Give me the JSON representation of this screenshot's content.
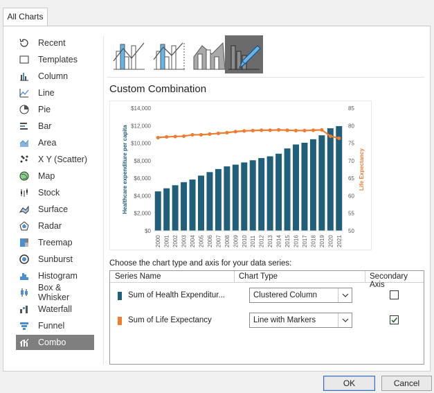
{
  "tabs": [
    {
      "label": "All Charts"
    }
  ],
  "sidebar": {
    "items": [
      {
        "label": "Recent",
        "icon": "recent-icon"
      },
      {
        "label": "Templates",
        "icon": "templates-icon"
      },
      {
        "label": "Column",
        "icon": "column-chart-icon"
      },
      {
        "label": "Line",
        "icon": "line-chart-icon"
      },
      {
        "label": "Pie",
        "icon": "pie-chart-icon"
      },
      {
        "label": "Bar",
        "icon": "bar-chart-icon"
      },
      {
        "label": "Area",
        "icon": "area-chart-icon"
      },
      {
        "label": "X Y (Scatter)",
        "icon": "scatter-chart-icon"
      },
      {
        "label": "Map",
        "icon": "map-chart-icon"
      },
      {
        "label": "Stock",
        "icon": "stock-chart-icon"
      },
      {
        "label": "Surface",
        "icon": "surface-chart-icon"
      },
      {
        "label": "Radar",
        "icon": "radar-chart-icon"
      },
      {
        "label": "Treemap",
        "icon": "treemap-chart-icon"
      },
      {
        "label": "Sunburst",
        "icon": "sunburst-chart-icon"
      },
      {
        "label": "Histogram",
        "icon": "histogram-chart-icon"
      },
      {
        "label": "Box & Whisker",
        "icon": "box-whisker-chart-icon"
      },
      {
        "label": "Waterfall",
        "icon": "waterfall-chart-icon"
      },
      {
        "label": "Funnel",
        "icon": "funnel-chart-icon"
      },
      {
        "label": "Combo",
        "icon": "combo-chart-icon",
        "selected": true
      }
    ]
  },
  "subtypes": [
    {
      "icon": "clustered-column-line-icon"
    },
    {
      "icon": "clustered-column-line-secondary-axis-icon"
    },
    {
      "icon": "stacked-area-clustered-column-icon"
    },
    {
      "icon": "custom-combination-icon",
      "selected": true
    }
  ],
  "main": {
    "section_title": "Custom Combination",
    "choose_label": "Choose the chart type and axis for your data series:"
  },
  "series_table": {
    "headers": {
      "series_name": "Series Name",
      "chart_type": "Chart Type",
      "secondary_axis": "Secondary Axis"
    },
    "rows": [
      {
        "name": "Sum of Health Expenditur...",
        "color": "#1f5f7a",
        "chart_type": "Clustered Column",
        "secondary_axis": false
      },
      {
        "name": "Sum of Life Expectancy",
        "color": "#ed7d31",
        "chart_type": "Line with Markers",
        "secondary_axis": true
      }
    ]
  },
  "buttons": {
    "ok": "OK",
    "cancel": "Cancel"
  },
  "chart_data": {
    "type": "bar",
    "categories": [
      "2000",
      "2001",
      "2002",
      "2003",
      "2004",
      "2005",
      "2006",
      "2007",
      "2008",
      "2009",
      "2010",
      "2011",
      "2012",
      "2013",
      "2014",
      "2015",
      "2016",
      "2017",
      "2018",
      "2019",
      "2020",
      "2021"
    ],
    "series": [
      {
        "name": "Sum of Health Expenditure",
        "type": "bar",
        "axis": "primary",
        "color": "#1f5f7a",
        "values": [
          4500,
          4850,
          5200,
          5550,
          5850,
          6300,
          6700,
          7050,
          7350,
          7550,
          7800,
          8050,
          8300,
          8500,
          8800,
          9400,
          9850,
          10050,
          10450,
          10900,
          11700,
          11950
        ]
      },
      {
        "name": "Sum of Life Expectancy",
        "type": "line",
        "axis": "secondary",
        "color": "#ed7d31",
        "values": [
          76.6,
          76.8,
          76.9,
          77.0,
          77.4,
          77.4,
          77.6,
          77.8,
          78.0,
          78.3,
          78.5,
          78.6,
          78.7,
          78.7,
          78.8,
          78.7,
          78.6,
          78.6,
          78.7,
          78.8,
          77.0,
          76.4
        ]
      }
    ],
    "ylabel": "Healthcare expenditure per capita",
    "y2label": "Life Expectancy",
    "ylim": [
      0,
      14000
    ],
    "y2lim": [
      50,
      85
    ],
    "yticks": [
      "$0",
      "$2,000",
      "$4,000",
      "$6,000",
      "$8,000",
      "$10,000",
      "$12,000",
      "$14,000"
    ],
    "y2ticks": [
      "50",
      "55",
      "60",
      "65",
      "70",
      "75",
      "80",
      "85"
    ],
    "grid": false,
    "legend": "none"
  }
}
